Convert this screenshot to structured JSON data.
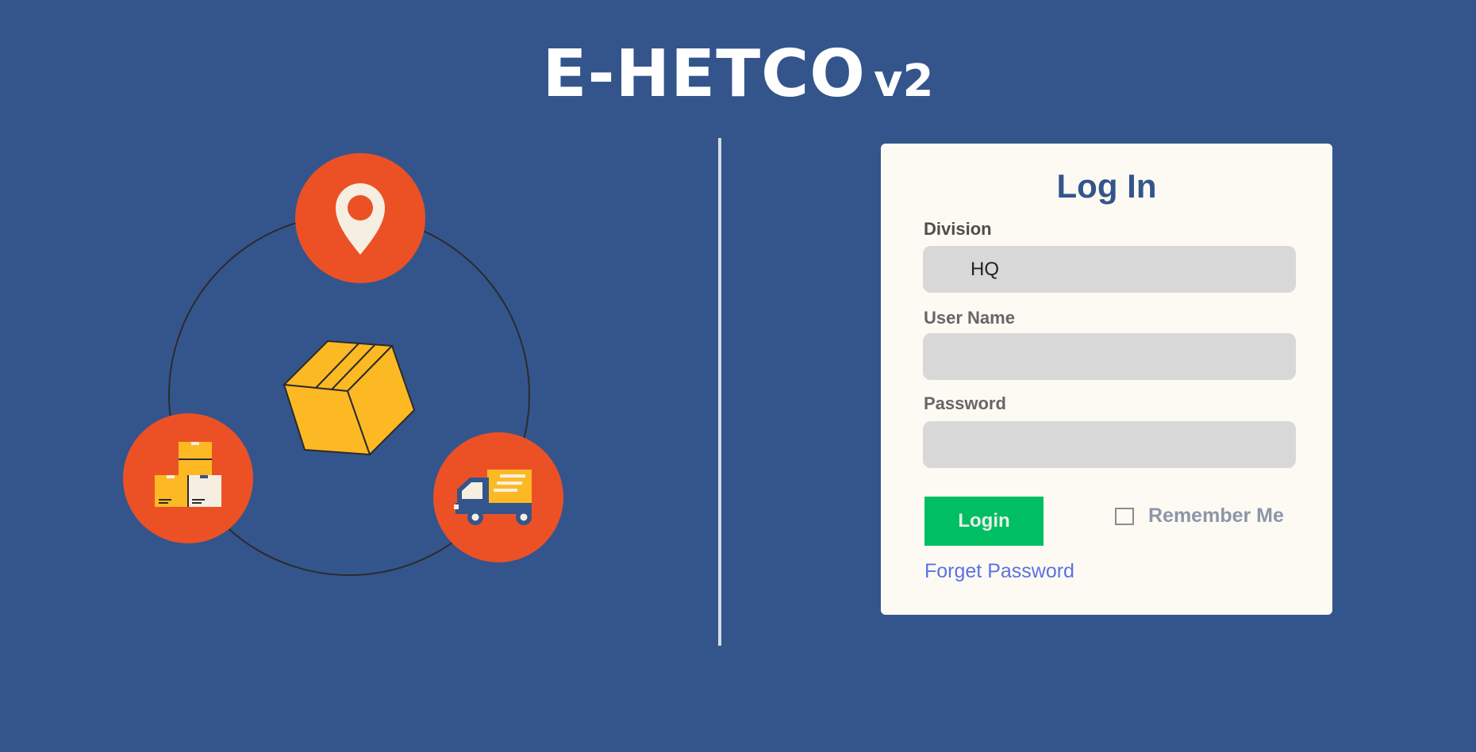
{
  "brand": {
    "name": "E-HETCO",
    "version": "v2"
  },
  "illustration": {
    "icons": [
      "location-pin-icon",
      "package-box-icon",
      "stacked-boxes-icon",
      "delivery-truck-icon"
    ],
    "colors": {
      "accent": "#ec5126",
      "box": "#fdb924",
      "pin": "#f6efe1"
    }
  },
  "login": {
    "title": "Log In",
    "division": {
      "label": "Division",
      "value": "HQ"
    },
    "username": {
      "label": "User Name",
      "value": ""
    },
    "password": {
      "label": "Password",
      "value": ""
    },
    "submit_label": "Login",
    "remember_label": "Remember Me",
    "remember_checked": false,
    "forget_label": "Forget Password"
  },
  "colors": {
    "background": "#34558c",
    "card": "#fdfaf4",
    "primary_button": "#00bf63",
    "link": "#5b72e0"
  }
}
